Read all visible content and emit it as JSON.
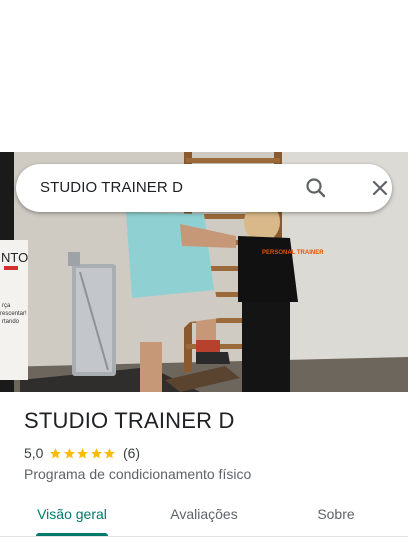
{
  "search": {
    "query": "STUDIO TRAINER D"
  },
  "hero": {
    "wall_sign_text": [
      "NTO",
      "rça",
      "rescentar!",
      "rtando"
    ],
    "shirt_text": "PERSONAL TRAINER"
  },
  "place": {
    "name": "STUDIO TRAINER D",
    "rating": "5,0",
    "stars_filled": 5,
    "review_count": "(6)",
    "category": "Programa de condicionamento físico"
  },
  "tabs": [
    {
      "label": "Visão geral",
      "active": true
    },
    {
      "label": "Avaliações",
      "active": false
    },
    {
      "label": "Sobre",
      "active": false
    }
  ],
  "colors": {
    "accent": "#00796b",
    "star": "#fbbc04",
    "text": "#202124",
    "secondary": "#5f6368"
  }
}
